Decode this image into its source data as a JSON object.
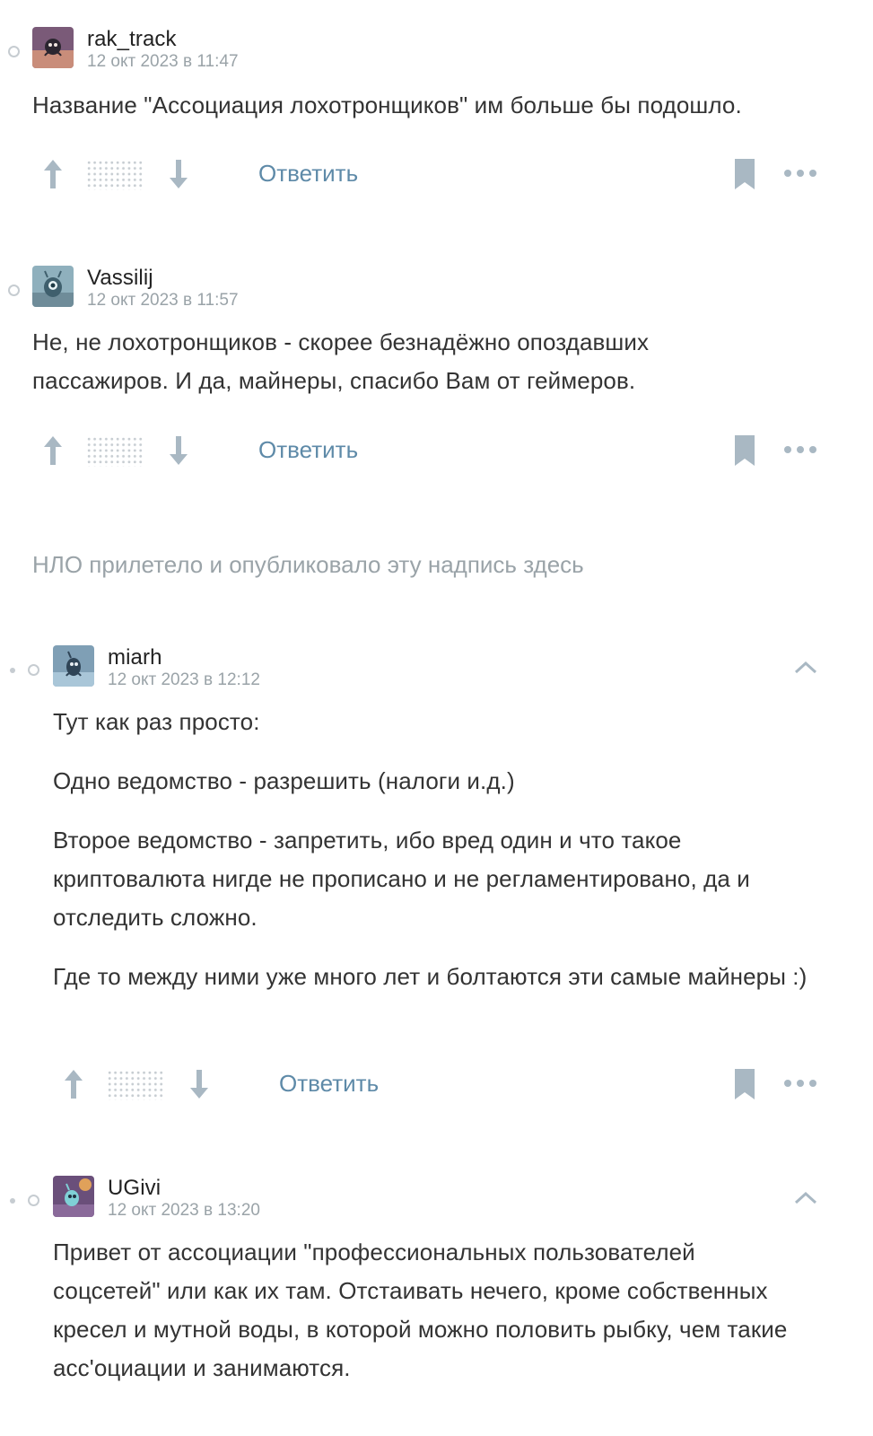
{
  "comments": [
    {
      "username": "rak_track",
      "timestamp": "12 окт 2023 в 11:47",
      "text": [
        "Название \"Ассоциация лохотронщиков\" им больше бы подошло."
      ],
      "reply_label": "Ответить",
      "avatar_colors": [
        "#5a4a6a",
        "#c98d7a"
      ]
    },
    {
      "username": "Vassilij",
      "timestamp": "12 окт 2023 в 11:57",
      "text": [
        "Не, не лохотронщиков - скорее безнадёжно опоздавших пассажиров. И да, майнеры, спасибо Вам от геймеров."
      ],
      "reply_label": "Ответить",
      "avatar_colors": [
        "#6f8c99",
        "#b8d6dd"
      ]
    },
    {
      "username": "miarh",
      "timestamp": "12 окт 2023 в 12:12",
      "text": [
        "Тут как раз просто:",
        "Одно ведомство - разрешить (налоги и.д.)",
        "Второе ведомство - запретить, ибо вред один и что такое криптовалюта нигде не прописано и не регламентировано, да и отследить сложно.",
        "Где то между ними уже много лет и болтаются эти самые майнеры :)"
      ],
      "reply_label": "Ответить",
      "avatar_colors": [
        "#4d6f8c",
        "#a9c6d8"
      ]
    },
    {
      "username": "UGivi",
      "timestamp": "12 окт 2023 в 13:20",
      "text": [
        "Привет от ассоциации \"профессиональных пользователей соцсетей\" или как их там. Отстаивать нечего, кроме собственных кресел и мутной воды, в которой можно половить рыбку, чем такие асс'оциации и занимаются."
      ],
      "reply_label": "Ответить",
      "avatar_colors": [
        "#6a4f7a",
        "#e0a15a"
      ]
    }
  ],
  "ufo_note": "НЛО прилетело и опубликовало эту надпись здесь",
  "icons": {
    "vote_up": "arrow-up-icon",
    "vote_down": "arrow-down-icon",
    "bookmark": "bookmark-icon",
    "more": "more-dots-icon",
    "collapse": "chevron-up-icon"
  },
  "colors": {
    "accent": "#5e8aa8",
    "icon": "#a9b8c3",
    "muted": "#9aa3a8"
  }
}
